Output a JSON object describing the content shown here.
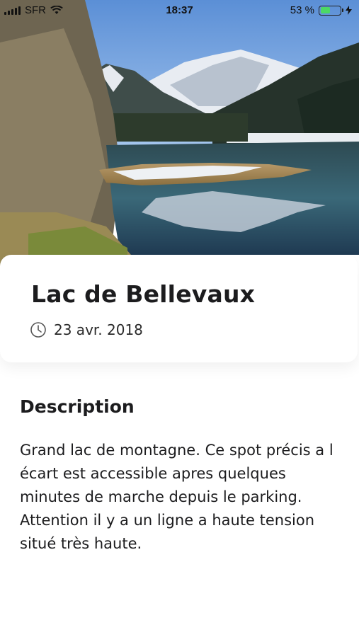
{
  "status_bar": {
    "carrier": "SFR",
    "time": "18:37",
    "battery_percent": "53 %",
    "battery_level": 0.53,
    "battery_color": "#4cd964"
  },
  "hero": {
    "image_icon": "landscape-photo"
  },
  "spot": {
    "title": "Lac de Bellevaux",
    "date": "23 avr. 2018",
    "date_icon": "clock-icon"
  },
  "description": {
    "heading": "Description",
    "body": "Grand lac de montagne. Ce spot précis a l écart est accessible apres quelques minutes de marche depuis le parking. Attention il y a un ligne a haute tension situé très haute."
  }
}
